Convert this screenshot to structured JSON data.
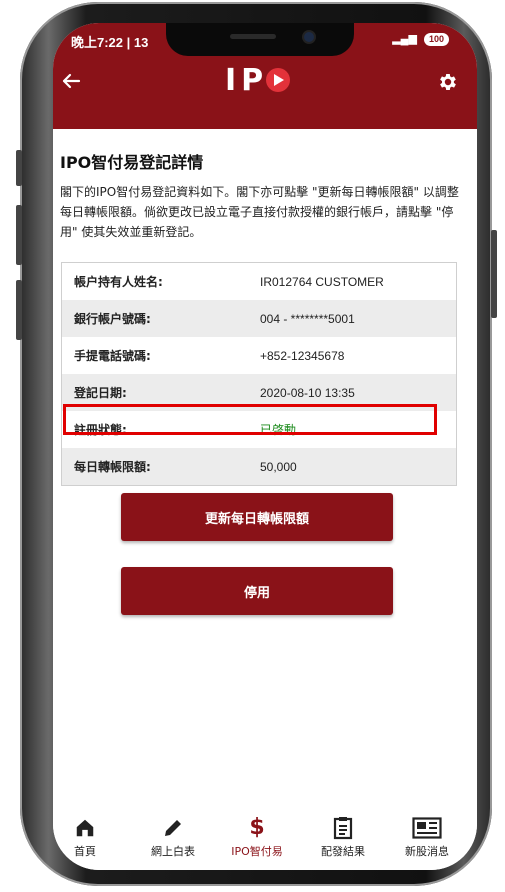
{
  "status": {
    "time": "晚上7:22 | 13",
    "battery": "100"
  },
  "header": {
    "logo_text": "IP"
  },
  "page": {
    "title": "IPO智付易登記詳情",
    "description": "閣下的IPO智付易登記資料如下。閣下亦可點擊 \"更新每日轉帳限額\" 以調整每日轉帳限額。倘欲更改已設立電子直接付款授權的銀行帳戶，請點擊 \"停用\" 使其失效並重新登記。"
  },
  "details": [
    {
      "label": "帳户持有人姓名:",
      "value": "IR012764 CUSTOMER"
    },
    {
      "label": "銀行帳户號碼:",
      "value": "004 - ********5001"
    },
    {
      "label": "手提電話號碼:",
      "value": "+852-12345678"
    },
    {
      "label": "登記日期:",
      "value": "2020-08-10 13:35"
    },
    {
      "label": "註冊狀態:",
      "value": "已啓動"
    },
    {
      "label": "每日轉帳限額:",
      "value": "50,000"
    }
  ],
  "buttons": {
    "update_limit": "更新每日轉帳限額",
    "deactivate": "停用"
  },
  "tabbar": [
    {
      "label": "首頁",
      "icon": "home-icon"
    },
    {
      "label": "網上白表",
      "icon": "pencil-icon"
    },
    {
      "label": "IPO智付易",
      "icon": "dollar-icon"
    },
    {
      "label": "配發結果",
      "icon": "clipboard-icon"
    },
    {
      "label": "新股消息",
      "icon": "newspaper-icon"
    }
  ],
  "colors": {
    "brand": "#8a1218",
    "status_active": "#1a8a1a",
    "highlight": "#e00000"
  }
}
